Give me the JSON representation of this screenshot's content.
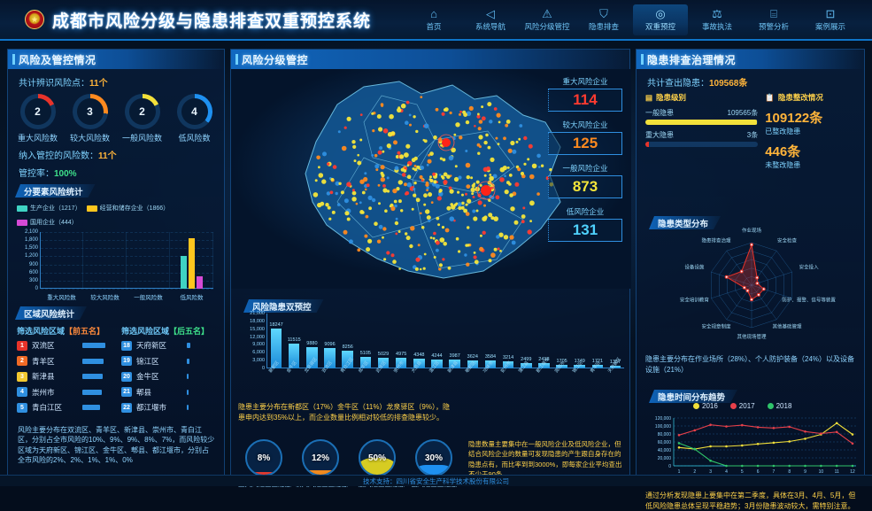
{
  "header": {
    "title": "成都市风险分级与隐患排查双重预控系统",
    "emblem_icon": "police-emblem-icon",
    "nav": [
      {
        "label": "首页",
        "icon": "home-icon",
        "active": false
      },
      {
        "label": "系统导航",
        "icon": "navigation-icon",
        "active": false
      },
      {
        "label": "风险分级管控",
        "icon": "warning-icon",
        "active": false
      },
      {
        "label": "隐患排查",
        "icon": "shield-icon",
        "active": false
      },
      {
        "label": "双重预控",
        "icon": "target-icon",
        "active": true
      },
      {
        "label": "事故执法",
        "icon": "gavel-icon",
        "active": false
      },
      {
        "label": "预警分析",
        "icon": "chart-icon",
        "active": false
      },
      {
        "label": "案例展示",
        "icon": "document-icon",
        "active": false
      }
    ]
  },
  "left": {
    "title": "风险及管控情况",
    "total_label": "共计辨识风险点：",
    "total_value": "11个",
    "rings": [
      {
        "value": "2",
        "label": "重大风险数",
        "color": "#e8332a",
        "pct": 18
      },
      {
        "value": "3",
        "label": "较大风险数",
        "color": "#ff8a1f",
        "pct": 27
      },
      {
        "value": "2",
        "label": "一般风险数",
        "color": "#f2e03a",
        "pct": 18
      },
      {
        "value": "4",
        "label": "低风险数",
        "color": "#1e90f0",
        "pct": 36
      }
    ],
    "controlled_label": "纳入管控的风险数：",
    "controlled_value": "11个",
    "rate_label": "管控率：",
    "rate_value": "100%",
    "sub_title": "分要素风险统计",
    "legend": [
      {
        "label": "生产企业（1217）",
        "color": "#3fd3c4"
      },
      {
        "label": "经营和储存企业（1866）",
        "color": "#ffc61e"
      },
      {
        "label": "国用企业（444）",
        "color": "#d64ad6"
      }
    ],
    "region_title": "区域风险统计",
    "region_top_title": "筛选风险区域",
    "region_top_tag": "【前五名】",
    "region_bottom_title": "筛选风险区域",
    "region_bottom_tag": "【后五名】",
    "region_top": [
      {
        "rank": "1",
        "name": "双流区",
        "bar": 26,
        "color": "#e8332a"
      },
      {
        "rank": "2",
        "name": "青羊区",
        "bar": 24,
        "color": "#f06a25"
      },
      {
        "rank": "3",
        "name": "新津县",
        "bar": 23,
        "color": "#f2c830"
      },
      {
        "rank": "4",
        "name": "崇州市",
        "bar": 22,
        "color": "#2f8fe0"
      },
      {
        "rank": "5",
        "name": "青白江区",
        "bar": 20,
        "color": "#2f8fe0"
      }
    ],
    "region_bottom": [
      {
        "rank": "18",
        "name": "天府新区",
        "bar": 4,
        "color": "#2f8fe0"
      },
      {
        "rank": "19",
        "name": "锦江区",
        "bar": 3,
        "color": "#2f8fe0"
      },
      {
        "rank": "20",
        "name": "金牛区",
        "bar": 2,
        "color": "#2f8fe0"
      },
      {
        "rank": "21",
        "name": "郫县",
        "bar": 2,
        "color": "#2f8fe0"
      },
      {
        "rank": "22",
        "name": "都江堰市",
        "bar": 2,
        "color": "#2f8fe0"
      }
    ],
    "note": "风险主要分布在双流区、青羊区、新津县、崇州市、青白江区，分别占全市风险的10%、9%、9%、8%、7%，而风险较少区域为天府新区、锦江区、金牛区、郫县、都江堰市，分别占全市风险的2%、2%、1%、1%、0%"
  },
  "center": {
    "title": "风险分级管控",
    "counters": [
      {
        "label": "重大风险企业",
        "value": "114",
        "color": "#ff3b30"
      },
      {
        "label": "较大风险企业",
        "value": "125",
        "color": "#ff8a1f"
      },
      {
        "label": "一般风险企业",
        "value": "873",
        "color": "#f5e63a"
      },
      {
        "label": "低风险企业",
        "value": "131",
        "color": "#4fd2ff"
      }
    ],
    "bar_title": "风险隐患双预控",
    "note": "隐患主要分布在新都区（17%）金牛区（11%）龙泉驿区（9%），隐患申内达到35%以上，而企业数量比例相对较低的排查隐患较少。",
    "gauges": [
      {
        "value": "8%",
        "label": "重大风险企业隐患",
        "pct": 8,
        "color": "#e0392f"
      },
      {
        "value": "12%",
        "label": "较大风险企业隐患",
        "pct": 12,
        "color": "#f08a1f"
      },
      {
        "value": "50%",
        "label": "一般风险企业隐患",
        "pct": 50,
        "color": "#d6cc22"
      },
      {
        "value": "30%",
        "label": "低风险企业隐患",
        "pct": 30,
        "color": "#1e90f0"
      }
    ],
    "gauge_note": "隐患数量主要集中在一般风险企业及低风险企业，但结合风险企业的数量可发现隐患的产生跟自身存在的隐患点有，而比率到到3000%，即每家企业平均查出不少于90条"
  },
  "right": {
    "title": "隐患排查治理情况",
    "total_label": "共计查出隐患：",
    "total_value": "109568条",
    "level_title": "隐患级别",
    "level_icon": "bars-icon",
    "levels": [
      {
        "name": "一般隐患",
        "value": "109565条",
        "pct": 99,
        "color": "#f2e03a"
      },
      {
        "name": "重大隐患",
        "value": "3条",
        "pct": 3,
        "color": "#e8332a"
      }
    ],
    "rectify_title": "隐患整改情况",
    "rectify_icon": "clipboard-icon",
    "rectified_value": "109122条",
    "rectified_label": "已整改隐患",
    "unrectified_value": "446条",
    "unrectified_label": "未整改隐患",
    "radar_title": "隐患类型分布",
    "radar_note": "隐患主要分布在作业场所（28%）、个人防护装备（24%）以及设备设施（21%）",
    "line_title": "隐患时间分布趋势",
    "line_note": "通过分析发现隐患上要集中在第二季度，具体在3月、4月、5月，但低风险隐患总体呈现平稳趋势；3月份隐患波动较大，需特别注意。"
  },
  "chart_data": [
    {
      "type": "bar",
      "title": "分要素风险统计",
      "categories": [
        "重大风险数",
        "较大风险数",
        "一般风险数",
        "低风险数"
      ],
      "series": [
        {
          "name": "生产企业",
          "values": [
            0,
            0,
            0,
            1217
          ],
          "color": "#3fd3c4"
        },
        {
          "name": "经营和储存企业",
          "values": [
            0,
            0,
            0,
            1866
          ],
          "color": "#ffc61e"
        },
        {
          "name": "国用企业",
          "values": [
            0,
            0,
            0,
            444
          ],
          "color": "#d64ad6"
        }
      ],
      "yticks": [
        "2,100",
        "1,800",
        "1,500",
        "1,200",
        "900",
        "600",
        "300",
        "0"
      ],
      "ylim": [
        0,
        2100
      ],
      "grid": true,
      "legend": "top"
    },
    {
      "type": "bar",
      "title": "风险隐患双预控",
      "categories": [
        "新都区",
        "金牛区",
        "龙泉驿区",
        "双流区",
        "青白江区",
        "成华区",
        "武侯区",
        "崇州市",
        "大邑县",
        "温江区",
        "新津县",
        "郫都区",
        "邛崃市",
        "彭州市",
        "蒲江县",
        "都江堰市",
        "简阳市",
        "锦江区",
        "青羊区",
        "天府新区"
      ],
      "values": [
        18247,
        11515,
        9880,
        9096,
        8256,
        5105,
        5029,
        4975,
        4348,
        4244,
        3987,
        3624,
        3584,
        3214,
        2499,
        2418,
        1705,
        1749,
        1721,
        1357
      ],
      "yticks": [
        "21,000",
        "18,000",
        "15,000",
        "12,000",
        "9,000",
        "6,000",
        "3,000",
        "0"
      ],
      "ylim": [
        0,
        21000
      ],
      "grid": true,
      "color": "#35b8f0"
    },
    {
      "type": "radar",
      "title": "隐患类型分布",
      "axes": [
        "作业现场",
        "安全检查",
        "安全投入",
        "防护、报警、信号等装置",
        "其他基础管理",
        "其他现场管理",
        "安全规章制度",
        "安全培训教育",
        "设备设施",
        "隐患排查治理"
      ],
      "values": [
        95,
        22,
        14,
        30,
        28,
        34,
        16,
        18,
        62,
        40
      ],
      "max": 100,
      "color": "#e8332a"
    },
    {
      "type": "line",
      "title": "隐患时间分布趋势",
      "x": [
        "1",
        "2",
        "3",
        "4",
        "5",
        "6",
        "7",
        "8",
        "9",
        "10",
        "11",
        "12"
      ],
      "yticks": [
        "120,000",
        "100,000",
        "80,000",
        "60,000",
        "40,000",
        "20,000",
        "0"
      ],
      "ylim": [
        0,
        120000
      ],
      "series": [
        {
          "name": "2016",
          "color": "#f2e03a",
          "values": [
            46000,
            42000,
            49000,
            49000,
            51000,
            55000,
            58000,
            61000,
            68000,
            79000,
            107000,
            79000
          ]
        },
        {
          "name": "2017",
          "color": "#e8404a",
          "values": [
            77000,
            89000,
            103000,
            99000,
            102000,
            97000,
            95000,
            98000,
            86000,
            81000,
            85000,
            56000
          ]
        },
        {
          "name": "2018",
          "color": "#2fc46a",
          "values": [
            57000,
            42000,
            13000,
            0,
            0,
            0,
            0,
            0,
            0,
            0,
            0,
            0
          ]
        }
      ],
      "legend": "top"
    }
  ],
  "footer": {
    "text": "技术支持：四川省安全生产科学技术股份有限公司"
  }
}
